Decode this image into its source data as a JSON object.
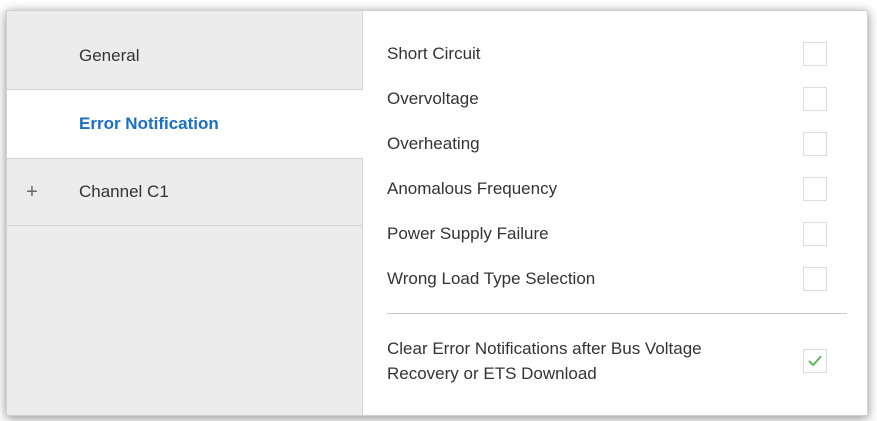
{
  "sidebar": {
    "items": [
      {
        "label": "General",
        "expander": ""
      },
      {
        "label": "Error Notification",
        "expander": ""
      },
      {
        "label": "Channel C1",
        "expander": "+"
      }
    ]
  },
  "main": {
    "params": [
      {
        "label": "Short Circuit",
        "checked": false
      },
      {
        "label": "Overvoltage",
        "checked": false
      },
      {
        "label": "Overheating",
        "checked": false
      },
      {
        "label": "Anomalous Frequency",
        "checked": false
      },
      {
        "label": "Power Supply Failure",
        "checked": false
      },
      {
        "label": "Wrong Load Type Selection",
        "checked": false
      }
    ],
    "clear": {
      "label_line1": "Clear Error Notifications after Bus Voltage",
      "label_line2": "Recovery or ETS Download",
      "checked": true
    }
  },
  "colors": {
    "active_tab_text": "#1a6fc4",
    "sidebar_bg": "#ececec",
    "check_mark": "#5cb85c"
  }
}
